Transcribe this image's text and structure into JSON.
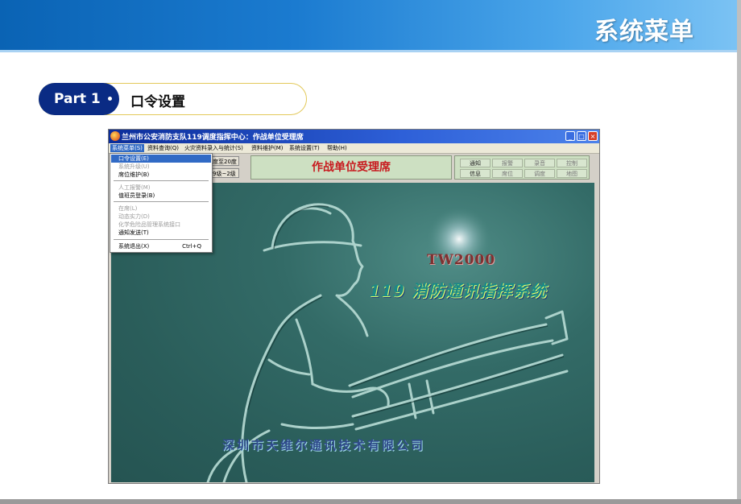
{
  "slide": {
    "title": "系统菜单",
    "part_label": "Part 1",
    "part_subtitle": "口令设置"
  },
  "window": {
    "title": "兰州市公安消防支队119调度指挥中心：作战单位受理席",
    "controls": {
      "minimize": "_",
      "maximize": "□",
      "close": "×"
    }
  },
  "menubar": {
    "items": [
      "系统菜单(S)",
      "资料查询(Q)",
      "火灾资料录入与统计(S)",
      "资料维护(M)",
      "系统设置(T)",
      "帮助(H)"
    ]
  },
  "toolbar": {
    "btn_top": "度至20度",
    "btn_bottom": "9级~2级",
    "seat_title": "作战单位受理席",
    "grid_buttons": [
      "通知",
      "报警",
      "录音",
      "控制",
      "信息",
      "席位",
      "调度",
      "地图"
    ]
  },
  "dropdown": {
    "items": [
      {
        "label": "口令设置(E)",
        "state": "selected"
      },
      {
        "label": "系统升级(U)",
        "state": "disabled"
      },
      {
        "label": "席位维护(B)",
        "state": "enabled"
      },
      {
        "label": "人工报警(M)",
        "state": "disabled"
      },
      {
        "label": "值班员登录(B)",
        "state": "enabled"
      },
      {
        "label": "在席(L)",
        "state": "disabled"
      },
      {
        "label": "动态实力(D)",
        "state": "disabled"
      },
      {
        "label": "化学危险品管理系统接口",
        "state": "disabled"
      },
      {
        "label": "通知发送(T)",
        "state": "enabled"
      },
      {
        "label": "系统退出(X)",
        "state": "enabled",
        "shortcut": "Ctrl+Q"
      }
    ]
  },
  "splash": {
    "brand": "TW2000",
    "system_name": "119 消防通讯指挥系统",
    "company": "深圳市天维尔通讯技术有限公司"
  },
  "colors": {
    "banner": "#1b7bd0",
    "part_dark": "#0a2b84",
    "seat_title": "#c8191e",
    "canvas": "#2a5d5a"
  }
}
